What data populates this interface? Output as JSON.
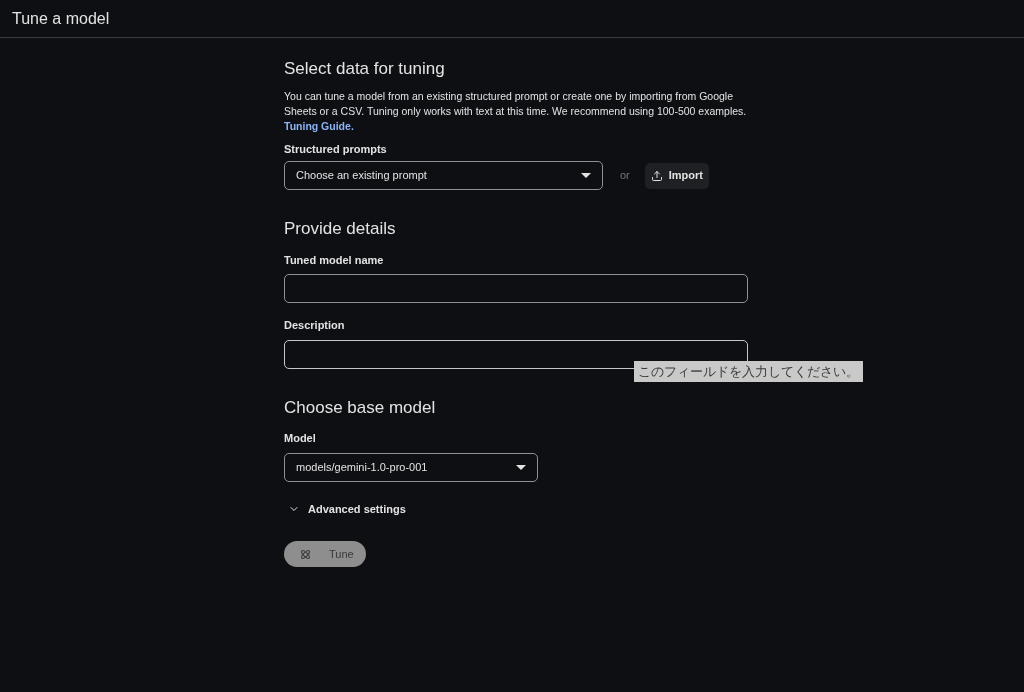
{
  "header": {
    "title": "Tune a model"
  },
  "select_data": {
    "heading": "Select data for tuning",
    "description": "You can tune a model from an existing structured prompt or create one by importing from Google Sheets or a CSV. Tuning only works with text at this time. We recommend using 100-500 examples.",
    "link": "Tuning Guide.",
    "label": "Structured prompts",
    "dropdown_value": "Choose an existing prompt",
    "separator": "or",
    "import_button": "Import"
  },
  "details": {
    "heading": "Provide details",
    "name_label": "Tuned model name",
    "description_label": "Description",
    "tooltip": "このフィールドを入力してください。"
  },
  "base_model": {
    "heading": "Choose base model",
    "label": "Model",
    "dropdown_value": "models/gemini-1.0-pro-001",
    "advanced": {
      "label": "Advanced settings",
      "expanded": false
    }
  },
  "tune_button": {
    "label": "Tune",
    "disabled": true
  }
}
